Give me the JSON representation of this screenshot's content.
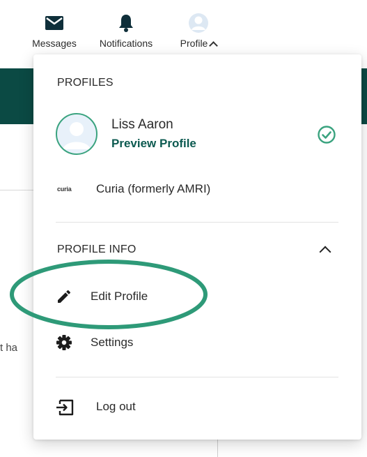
{
  "topnav": {
    "messages_label": "Messages",
    "notifications_label": "Notifications",
    "profile_label": "Profile"
  },
  "background": {
    "partial_text": "t ha"
  },
  "dropdown": {
    "profiles_heading": "PROFILES",
    "user": {
      "name": "Liss Aaron",
      "preview_link": "Preview Profile"
    },
    "organization": {
      "logo_text": "curia",
      "name": "Curia (formerly AMRI)"
    },
    "profile_info_heading": "PROFILE INFO",
    "menu": {
      "edit_profile": "Edit Profile",
      "settings": "Settings",
      "log_out": "Log out"
    }
  },
  "colors": {
    "accent_green": "#3aa37f",
    "link_green": "#0c5a50",
    "annotation_green": "#2e9a78",
    "banner_teal": "#0b4a44"
  },
  "icons": {
    "messages": "envelope-icon",
    "notifications": "bell-icon",
    "profile": "avatar-icon",
    "active_profile": "check-circle-icon",
    "edit": "pencil-icon",
    "settings": "gear-icon",
    "logout": "logout-icon"
  }
}
